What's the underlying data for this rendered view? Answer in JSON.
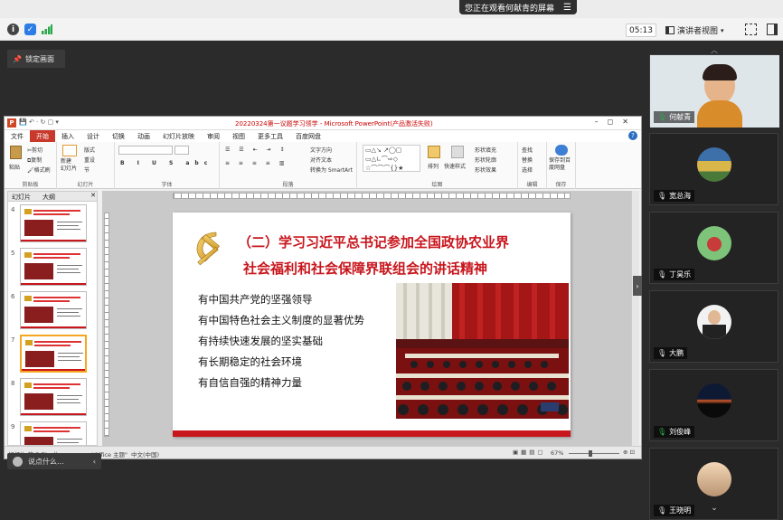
{
  "meeting": {
    "share_banner": "您正在观看何献青的屏幕",
    "timer": "05:13",
    "view_mode": "演讲者视图",
    "lock_screen": "锁定画面",
    "chat_placeholder": "说点什么..."
  },
  "ppt": {
    "title": "20220324第一议题学习领学 - Microsoft PowerPoint(产品激活失败)",
    "menu": [
      "文件",
      "开始",
      "插入",
      "设计",
      "切换",
      "动画",
      "幻灯片放映",
      "审阅",
      "视图",
      "更多工具",
      "百度网盘"
    ],
    "active_menu_index": 1,
    "ribbon": {
      "paste": "粘贴",
      "cut": "剪切",
      "copy": "复制",
      "format_painter": "格式刷",
      "new_slide": "新建\n幻灯片",
      "layout": "版式",
      "reset": "重设",
      "section": "节",
      "text_direction": "文字方向",
      "align_text": "对齐文本",
      "smartart": "转换为 SmartArt",
      "arrange": "排列",
      "quick_styles": "快速样式",
      "shape_fill": "形状填充",
      "shape_outline": "形状轮廓",
      "shape_effects": "形状效果",
      "find": "查找",
      "replace": "替换",
      "select": "选择",
      "save_to_baidu": "保存到百\n度网盘",
      "groups": [
        "剪贴板",
        "幻灯片",
        "字体",
        "段落",
        "绘图",
        "编辑",
        "保存"
      ]
    },
    "panel_tabs": [
      "幻灯片",
      "大纲"
    ],
    "thumb_numbers": [
      "4",
      "5",
      "6",
      "7",
      "8",
      "9"
    ],
    "selected_thumb": 3,
    "status": {
      "slide_info": "幻灯片 第 7 张，共 ...",
      "theme": "\"Office 主题\"",
      "language": "中文(中国)",
      "zoom": "67%"
    }
  },
  "slide": {
    "title_line1": "（二）学习习近平总书记参加全国政协农业界",
    "title_line2": "社会福利和社会保障界联组会的讲话精神",
    "bullets": [
      "有中国共产党的坚强领导",
      "有中国特色社会主义制度的显著优势",
      "有持续快速发展的坚实基础",
      "有长期稳定的社会环境",
      "有自信自强的精神力量"
    ]
  },
  "participants": [
    {
      "name": "何献青",
      "status": "mic-on"
    },
    {
      "name": "宽总海",
      "status": "mic-muted"
    },
    {
      "name": "丁昊乐",
      "status": "mic-muted"
    },
    {
      "name": "大鹏",
      "status": "mic-muted"
    },
    {
      "name": "刘俊峰",
      "status": "mic-on"
    },
    {
      "name": "王晓明",
      "status": "mic-muted"
    }
  ],
  "colors": {
    "accent_red": "#c8161d",
    "office_red": "#c8392b"
  }
}
